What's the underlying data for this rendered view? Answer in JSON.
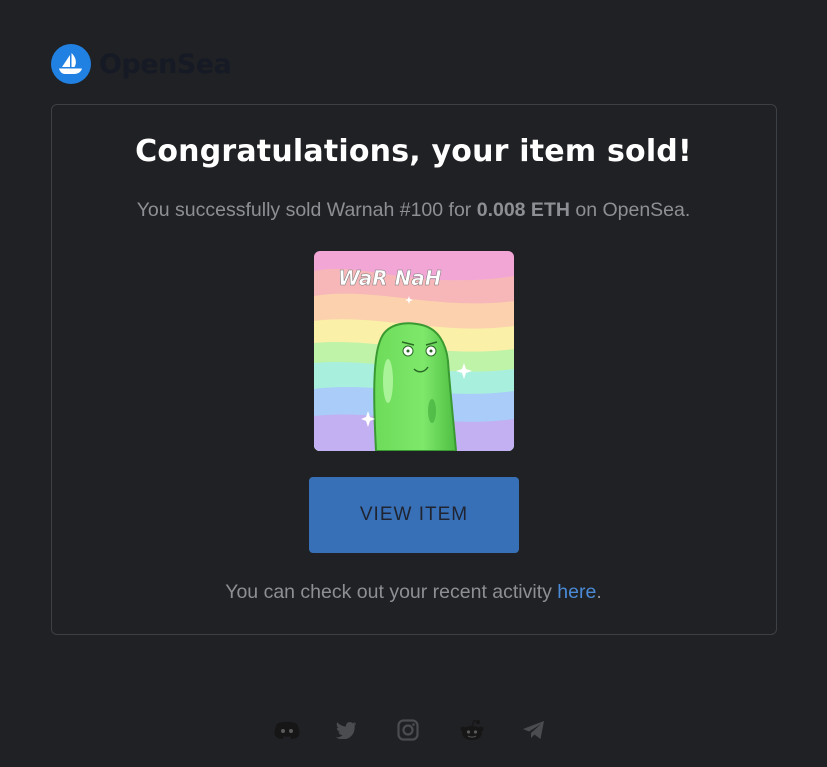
{
  "brand": {
    "name": "OpenSea",
    "logo": "sailboat-icon",
    "color": "#2081e2"
  },
  "email": {
    "heading": "Congratulations, your item sold!",
    "message": {
      "prefix": "You successfully sold Warnah #100 for ",
      "amount": "0.008 ETH",
      "suffix": " on OpenSea."
    },
    "nft": {
      "art_text": "WaR NaH",
      "image": "green-pickle-character-on-rainbow"
    },
    "button_label": "VIEW ITEM",
    "activity": {
      "prefix": "You can check out your recent activity ",
      "link": "here",
      "suffix": "."
    }
  },
  "socials": [
    "discord-icon",
    "twitter-icon",
    "instagram-icon",
    "reddit-icon",
    "telegram-icon"
  ],
  "colors": {
    "background": "#202124",
    "button": "#3870b7",
    "link": "#4a8ad6",
    "text_muted": "#8d8f94"
  }
}
